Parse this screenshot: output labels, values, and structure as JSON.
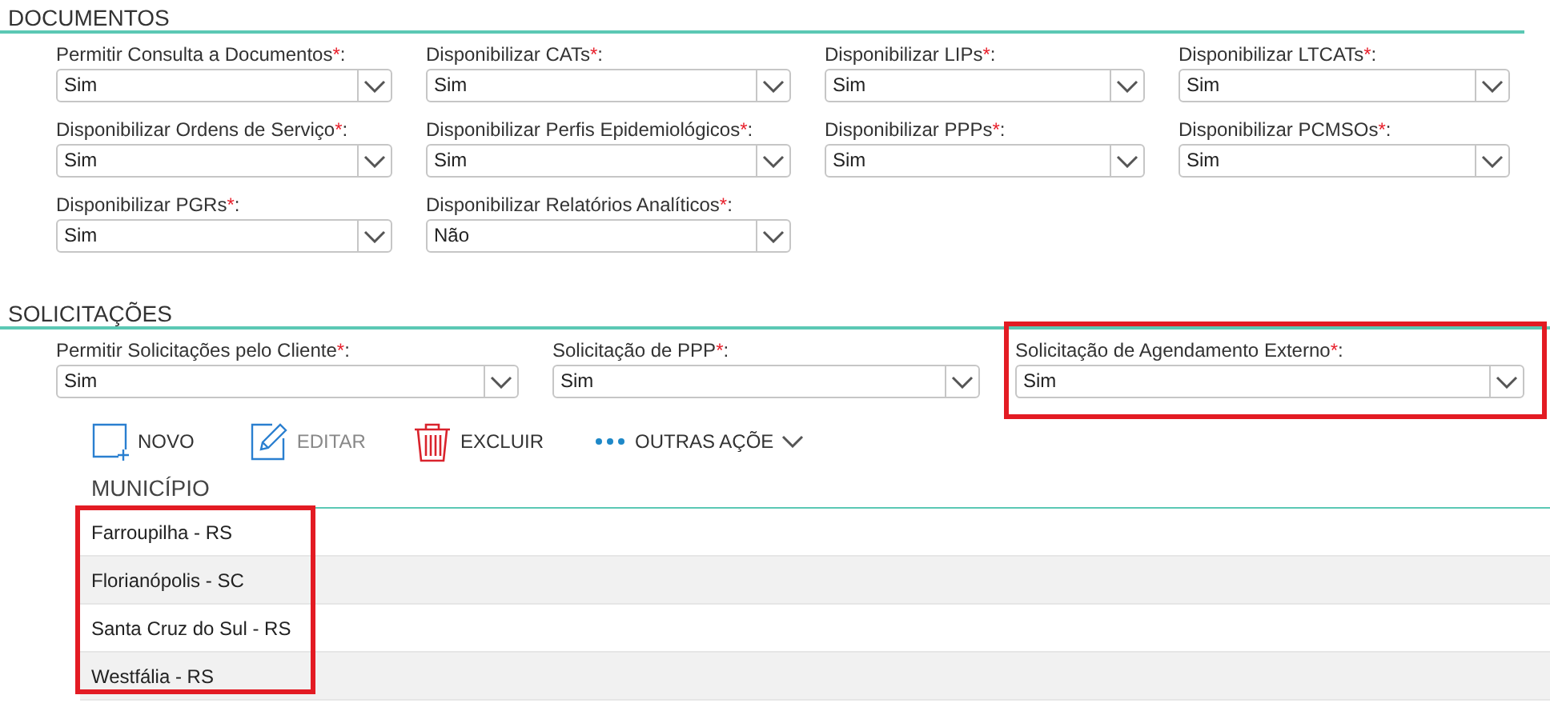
{
  "sections": [
    {
      "title": "DOCUMENTOS",
      "rows": [
        [
          {
            "label": "Permitir Consulta a Documentos",
            "required_mark": "*",
            "colon": ":",
            "value": "Sim",
            "highlighted": false
          },
          {
            "label": "Disponibilizar CATs",
            "required_mark": "*",
            "colon": ":",
            "value": "Sim",
            "highlighted": false
          },
          {
            "label": "Disponibilizar LIPs",
            "required_mark": "*",
            "colon": ":",
            "value": "Sim",
            "highlighted": false
          },
          {
            "label": "Disponibilizar LTCATs",
            "required_mark": "*",
            "colon": ":",
            "value": "Sim",
            "highlighted": false
          }
        ],
        [
          {
            "label": "Disponibilizar Ordens de Serviço",
            "required_mark": "*",
            "colon": ":",
            "value": "Sim",
            "highlighted": false
          },
          {
            "label": "Disponibilizar Perfis Epidemiológicos",
            "required_mark": "*",
            "colon": ":",
            "value": "Sim",
            "highlighted": false
          },
          {
            "label": "Disponibilizar PPPs",
            "required_mark": "*",
            "colon": ":",
            "value": "Sim",
            "highlighted": false
          },
          {
            "label": "Disponibilizar PCMSOs",
            "required_mark": "*",
            "colon": ":",
            "value": "Sim",
            "highlighted": false
          }
        ],
        [
          {
            "label": "Disponibilizar PGRs",
            "required_mark": "*",
            "colon": ":",
            "value": "Sim",
            "highlighted": false
          },
          {
            "label": "Disponibilizar Relatórios Analíticos",
            "required_mark": "*",
            "colon": ":",
            "value": "Não",
            "highlighted": false
          }
        ]
      ]
    },
    {
      "title": "SOLICITAÇÕES",
      "rows": [
        [
          {
            "label": "Permitir Solicitações pelo Cliente",
            "required_mark": "*",
            "colon": ":",
            "value": "Sim",
            "highlighted": false
          },
          {
            "label": "Solicitação de PPP",
            "required_mark": "*",
            "colon": ":",
            "value": "Sim",
            "highlighted": false
          },
          {
            "label": "Solicitação de Agendamento Externo",
            "required_mark": "*",
            "colon": ":",
            "value": "Sim",
            "highlighted": true
          }
        ]
      ]
    }
  ],
  "toolbar": [
    {
      "kind": "new",
      "label": "NOVO",
      "disabled": false
    },
    {
      "kind": "edit",
      "label": "EDITAR",
      "disabled": true
    },
    {
      "kind": "delete",
      "label": "EXCLUIR",
      "disabled": false
    },
    {
      "kind": "more",
      "label": "OUTRAS AÇÕE",
      "disabled": false
    }
  ],
  "table": {
    "columns": [
      "MUNICÍPIO"
    ],
    "highlighted": true,
    "rows": [
      [
        "Farroupilha - RS"
      ],
      [
        "Florianópolis - SC"
      ],
      [
        "Santa Cruz do Sul - RS"
      ],
      [
        "Westfália - RS"
      ]
    ]
  }
}
